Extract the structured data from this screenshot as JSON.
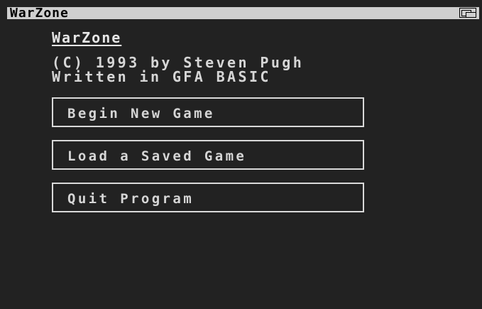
{
  "window": {
    "title": "WarZone",
    "depth_gadget_icon": "window-depth-icon"
  },
  "main": {
    "heading": "WarZone",
    "credit_line_1": "(C) 1993 by Steven Pugh",
    "credit_line_2": "Written in GFA BASIC",
    "menu": {
      "begin_new_game": "Begin New Game",
      "load_saved_game": "Load a Saved Game",
      "quit_program": "Quit Program"
    }
  },
  "colors": {
    "background": "#222222",
    "titlebar": "#cfcfcf",
    "text": "#d9d9d9"
  }
}
